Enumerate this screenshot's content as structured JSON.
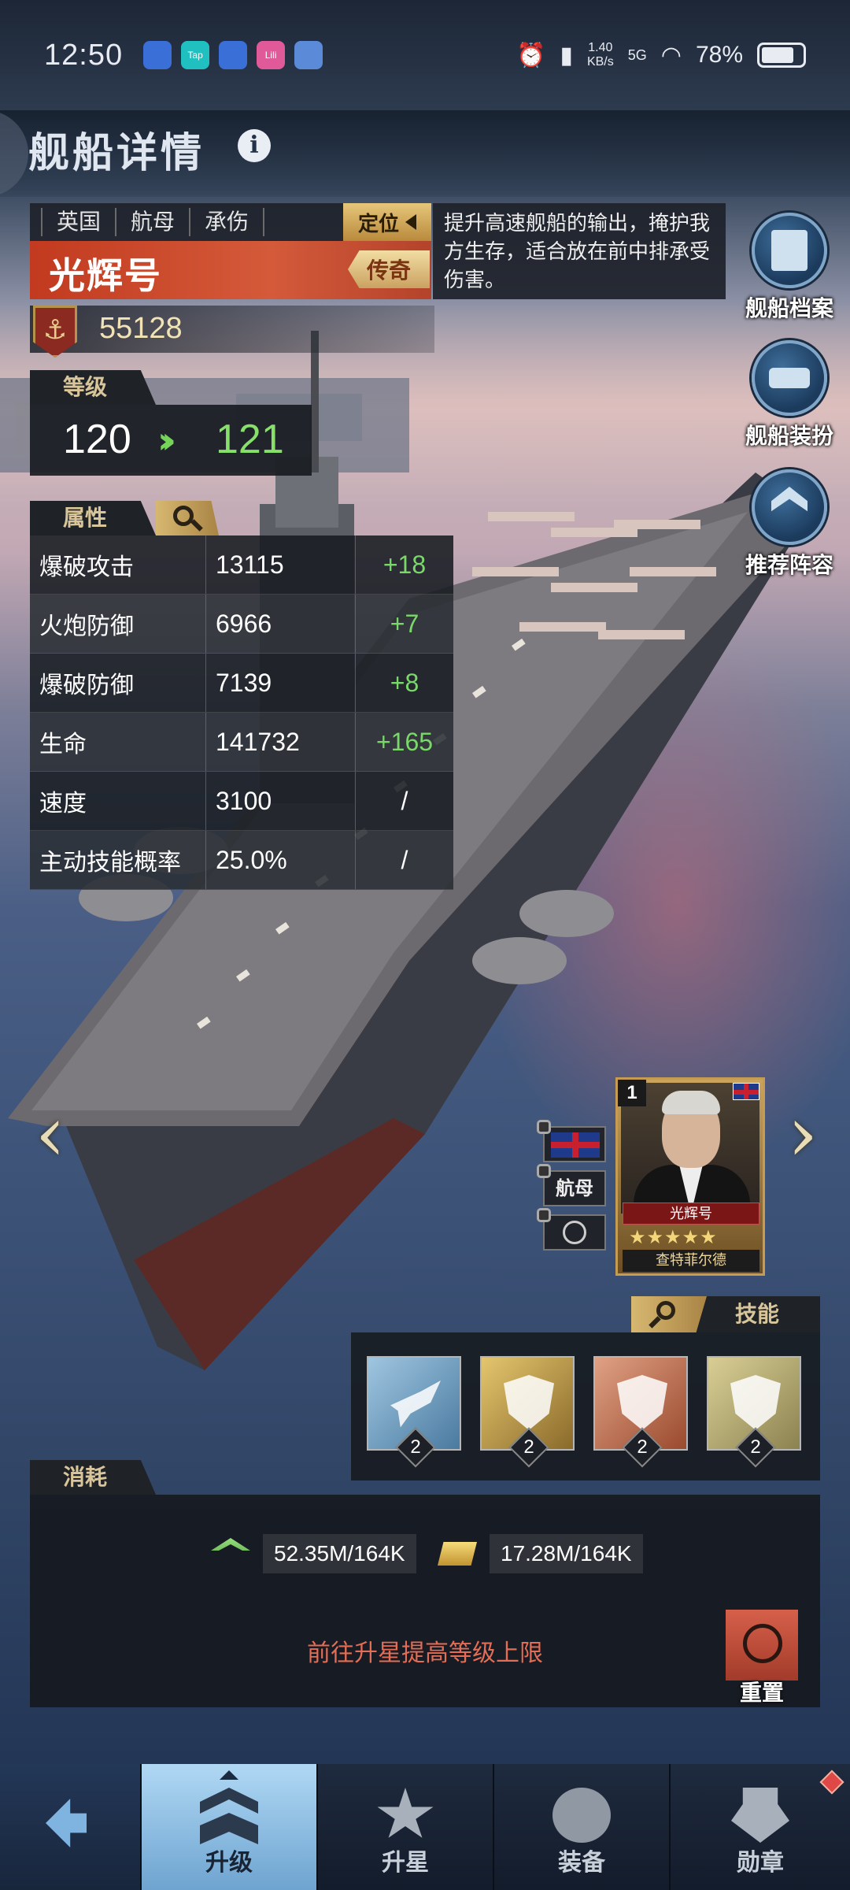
{
  "status_bar": {
    "time": "12:50",
    "apps": [
      "Tap",
      "Lili"
    ],
    "net_speed": "1.40",
    "net_unit": "KB/s",
    "signal": "5G",
    "battery": "78%"
  },
  "header": {
    "title": "舰船详情",
    "info_icon": "i"
  },
  "ship": {
    "tags": [
      "英国",
      "航母",
      "承伤"
    ],
    "role_label": "定位",
    "name": "光辉号",
    "rarity": "传奇",
    "description": "提升高速舰船的输出，掩护我方生存，适合放在前中排承受伤害。",
    "power": "55128"
  },
  "level": {
    "section_label": "等级",
    "current": "120",
    "next": "121"
  },
  "attributes": {
    "section_label": "属性",
    "rows": [
      {
        "name": "爆破攻击",
        "value": "13115",
        "increase": "+18"
      },
      {
        "name": "火炮防御",
        "value": "6966",
        "increase": "+7"
      },
      {
        "name": "爆破防御",
        "value": "7139",
        "increase": "+8"
      },
      {
        "name": "生命",
        "value": "141732",
        "increase": "+165"
      },
      {
        "name": "速度",
        "value": "3100",
        "increase": "/"
      },
      {
        "name": "主动技能概率",
        "value": "25.0%",
        "increase": "/"
      }
    ]
  },
  "side_buttons": {
    "archive": "舰船档案",
    "skin": "舰船装扮",
    "lineup": "推荐阵容"
  },
  "navigation": {
    "prev": "‹",
    "next": "›"
  },
  "captain": {
    "level": "1",
    "ship_name": "光辉号",
    "stars": "★★★★★",
    "name": "查特菲尔德",
    "type_tag": "航母"
  },
  "skills": {
    "section_label": "技能",
    "items": [
      {
        "count": "2"
      },
      {
        "count": "2"
      },
      {
        "count": "2"
      },
      {
        "count": "2"
      }
    ]
  },
  "consumption": {
    "section_label": "消耗",
    "exp": "52.35M/164K",
    "gold": "17.28M/164K",
    "hint": "前往升星提高等级上限",
    "reset_label": "重置"
  },
  "bottom_nav": {
    "levelup": "升级",
    "star": "升星",
    "equip": "装备",
    "medal": "勋章"
  },
  "colors": {
    "accent_red": "#c23a1f",
    "increase_green": "#7ad86a",
    "hint_red": "#e46d55",
    "gold": "#d7b870"
  }
}
